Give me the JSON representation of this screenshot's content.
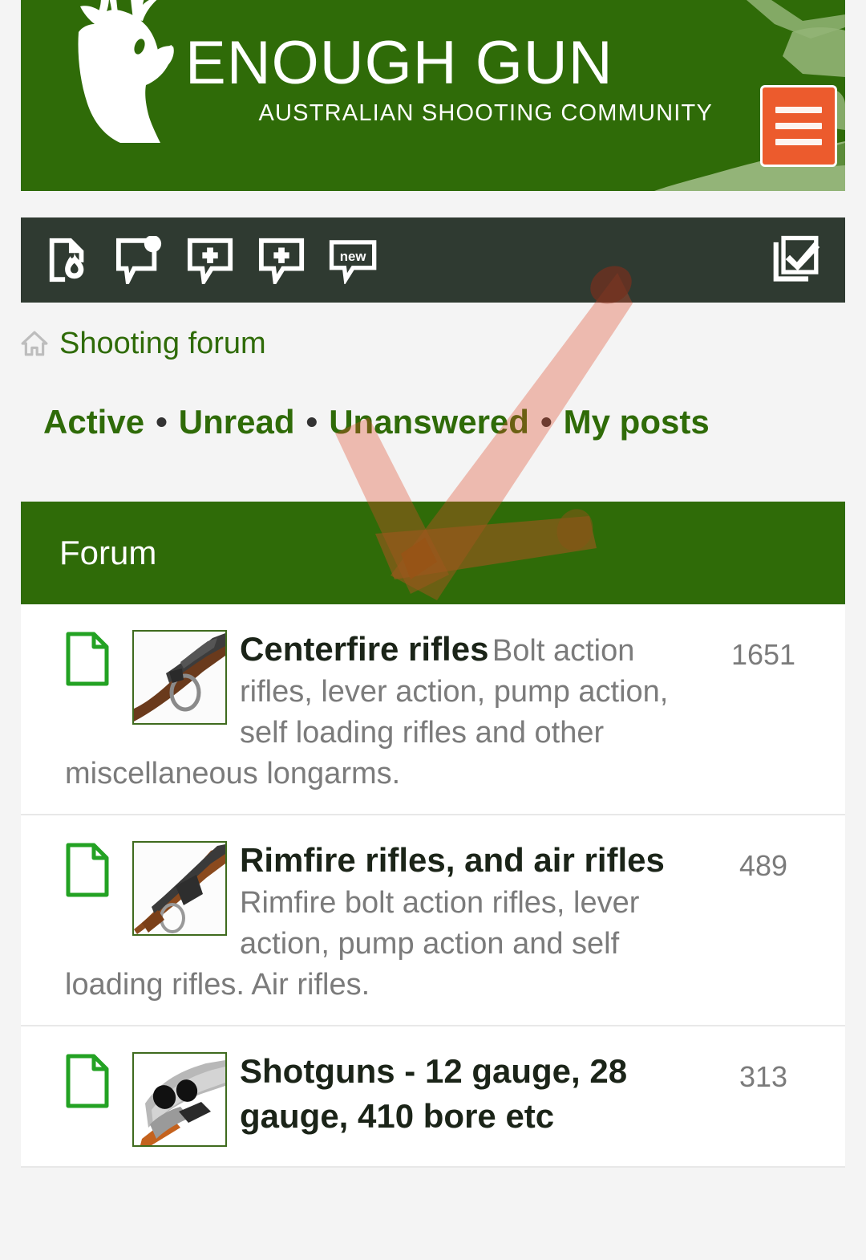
{
  "site": {
    "brand_title": "ENOUGH GUN",
    "brand_subtitle": "AUSTRALIAN SHOOTING COMMUNITY",
    "logo_icon": "deer-head-icon",
    "banner_color": "#2f6b08",
    "menu_button_color": "#ec5b2d",
    "menu_icon": "hamburger-icon"
  },
  "toolbar": {
    "background_color": "#2f3a31",
    "items": [
      {
        "icon": "hot-topics-icon",
        "label": "Hot topics"
      },
      {
        "icon": "unanswered-posts-icon",
        "label": "Unanswered posts"
      },
      {
        "icon": "new-post-icon",
        "label": "New post"
      },
      {
        "icon": "new-topic-icon",
        "label": "New topic"
      },
      {
        "icon": "new-posts-icon",
        "label": "new"
      }
    ],
    "mark_read": {
      "icon": "mark-all-read-icon",
      "label": "Mark all read"
    }
  },
  "breadcrumb": {
    "home_icon": "home-icon",
    "items": [
      {
        "label": "Shooting forum"
      }
    ]
  },
  "navlinks": {
    "separator": "•",
    "items": [
      {
        "label": "Active"
      },
      {
        "label": "Unread"
      },
      {
        "label": "Unanswered"
      },
      {
        "label": "My posts"
      }
    ]
  },
  "forum_table": {
    "header": "Forum",
    "header_color": "#2f6b08",
    "rows": [
      {
        "status_icon": "unread-document-icon",
        "thumb_icon": "bolt-action-rifle-thumb",
        "title": "Centerfire rifles",
        "description": "Bolt action rifles, lever action, pump action, self loading rifles and other miscellaneous longarms.",
        "count": "1651"
      },
      {
        "status_icon": "unread-document-icon",
        "thumb_icon": "rimfire-rifle-thumb",
        "title": "Rimfire rifles, and air rifles",
        "description": "Rimfire bolt action rifles, lever action, pump action and self loading rifles. Air rifles.",
        "count": "489"
      },
      {
        "status_icon": "unread-document-icon",
        "thumb_icon": "double-barrel-shotgun-thumb",
        "title": "Shotguns - 12 gauge, 28 gauge, 410 bore etc",
        "description": "",
        "count": "313"
      }
    ]
  },
  "annotation": {
    "type": "checkmark-gesture",
    "color": "#e04a2a"
  }
}
